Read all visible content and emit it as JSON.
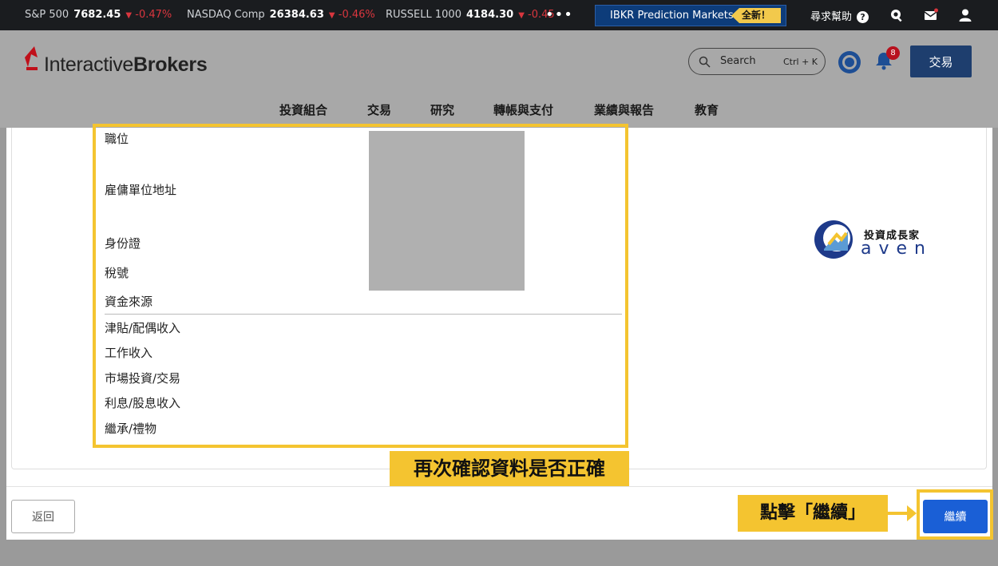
{
  "ticker": {
    "items": [
      {
        "name": "S&P 500",
        "value": "7682.45",
        "change": "-0.47%"
      },
      {
        "name": "NASDAQ Comp",
        "value": "26384.63",
        "change": "-0.46%"
      },
      {
        "name": "RUSSELL 1000",
        "value": "4184.30",
        "change": "-0.45"
      }
    ],
    "more": "•••",
    "promo_label": "IBKR Prediction Markets",
    "promo_badge": "全新！",
    "help_label": "尋求幫助"
  },
  "header": {
    "logo_part1": "Interactive",
    "logo_part2": "Brokers",
    "search_label": "Search",
    "search_shortcut": "Ctrl + K",
    "notification_count": "8",
    "trade_button": "交易"
  },
  "nav": {
    "items": [
      "投資組合",
      "交易",
      "研究",
      "轉帳與支付",
      "業績與報告",
      "教育"
    ]
  },
  "form": {
    "labels": [
      "職位",
      "雇傭單位地址",
      "身份證",
      "稅號",
      "資金來源"
    ],
    "sources": [
      "津貼/配偶收入",
      "工作收入",
      "市場投資/交易",
      "利息/股息收入",
      "繼承/禮物"
    ]
  },
  "annotations": {
    "review_note": "再次確認資料是否正確",
    "click_note": "點擊「繼續」"
  },
  "brand": {
    "chinese": "投資成長家",
    "english": "aven"
  },
  "footer": {
    "back_button": "返回",
    "continue_button": "繼續"
  },
  "colors": {
    "highlight": "#f4c430",
    "primary_button": "#1a5fd6",
    "trade_button": "#1e3e6e",
    "negative": "#d9363e"
  }
}
